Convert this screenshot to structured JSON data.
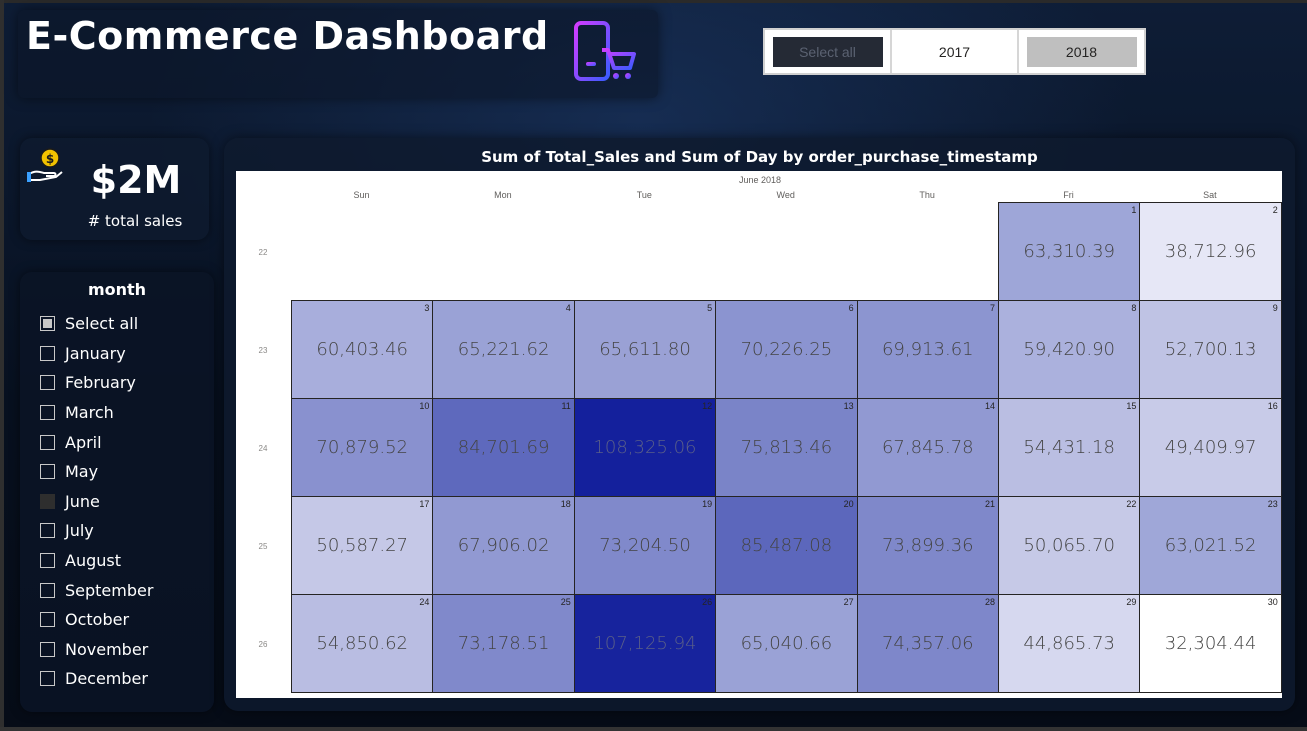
{
  "header": {
    "title": "E-Commerce Dashboard",
    "icon": "phone-shopping-cart-icon"
  },
  "year_slicer": {
    "options": [
      {
        "label": "Select all",
        "state": "dark"
      },
      {
        "label": "2017",
        "state": "white"
      },
      {
        "label": "2018",
        "state": "grey"
      }
    ]
  },
  "kpi": {
    "value": "$2M",
    "label": "# total sales",
    "icon": "hand-coin-icon"
  },
  "month_slicer": {
    "header": "month",
    "items": [
      {
        "label": "Select all",
        "check": "partial"
      },
      {
        "label": "January",
        "check": "none"
      },
      {
        "label": "February",
        "check": "none"
      },
      {
        "label": "March",
        "check": "none"
      },
      {
        "label": "April",
        "check": "none"
      },
      {
        "label": "May",
        "check": "none"
      },
      {
        "label": "June",
        "check": "filled"
      },
      {
        "label": "July",
        "check": "none"
      },
      {
        "label": "August",
        "check": "none"
      },
      {
        "label": "September",
        "check": "none"
      },
      {
        "label": "October",
        "check": "none"
      },
      {
        "label": "November",
        "check": "none"
      },
      {
        "label": "December",
        "check": "none"
      }
    ]
  },
  "calendar": {
    "title": "Sum of Total_Sales and Sum of Day by order_purchase_timestamp",
    "month_label": "June 2018",
    "weekdays": [
      "Sun",
      "Mon",
      "Tue",
      "Wed",
      "Thu",
      "Fri",
      "Sat"
    ],
    "weeks": [
      "22",
      "23",
      "24",
      "25",
      "26"
    ],
    "days": [
      {
        "day": "1",
        "value": "63,310.39",
        "color": "#9ea6d8",
        "text": "#444444"
      },
      {
        "day": "2",
        "value": "38,712.96",
        "color": "#e6e7f6",
        "text": "#444444"
      },
      {
        "day": "3",
        "value": "60,403.46",
        "color": "#a8aedc",
        "text": "#444444"
      },
      {
        "day": "4",
        "value": "65,221.62",
        "color": "#9aa2d6",
        "text": "#444444"
      },
      {
        "day": "5",
        "value": "65,611.80",
        "color": "#9aa1d5",
        "text": "#444444"
      },
      {
        "day": "6",
        "value": "70,226.25",
        "color": "#8b94d0",
        "text": "#444444"
      },
      {
        "day": "7",
        "value": "69,913.61",
        "color": "#8c95d0",
        "text": "#444444"
      },
      {
        "day": "8",
        "value": "59,420.90",
        "color": "#abb1dd",
        "text": "#444444"
      },
      {
        "day": "9",
        "value": "52,700.13",
        "color": "#bfc3e4",
        "text": "#444444"
      },
      {
        "day": "10",
        "value": "70,879.52",
        "color": "#8991cf",
        "text": "#444444"
      },
      {
        "day": "11",
        "value": "84,701.69",
        "color": "#5e69bd",
        "text": "#444444"
      },
      {
        "day": "12",
        "value": "108,325.06",
        "color": "#14209c",
        "text": "#5a5f88"
      },
      {
        "day": "13",
        "value": "75,813.46",
        "color": "#7a84c8",
        "text": "#444444"
      },
      {
        "day": "14",
        "value": "67,845.78",
        "color": "#9199d2",
        "text": "#444444"
      },
      {
        "day": "15",
        "value": "54,431.18",
        "color": "#babee2",
        "text": "#444444"
      },
      {
        "day": "16",
        "value": "49,409.97",
        "color": "#c8cbe8",
        "text": "#444444"
      },
      {
        "day": "17",
        "value": "50,587.27",
        "color": "#c5c8e7",
        "text": "#444444"
      },
      {
        "day": "18",
        "value": "67,906.02",
        "color": "#9199d2",
        "text": "#444444"
      },
      {
        "day": "19",
        "value": "73,204.50",
        "color": "#8089cb",
        "text": "#444444"
      },
      {
        "day": "20",
        "value": "85,487.08",
        "color": "#5c67bc",
        "text": "#444444"
      },
      {
        "day": "21",
        "value": "73,899.36",
        "color": "#7f88ca",
        "text": "#444444"
      },
      {
        "day": "22",
        "value": "50,065.70",
        "color": "#c6c9e7",
        "text": "#444444"
      },
      {
        "day": "23",
        "value": "63,021.52",
        "color": "#9fa7d8",
        "text": "#444444"
      },
      {
        "day": "24",
        "value": "54,850.62",
        "color": "#b9bde2",
        "text": "#444444"
      },
      {
        "day": "25",
        "value": "73,178.51",
        "color": "#8089cb",
        "text": "#444444"
      },
      {
        "day": "26",
        "value": "107,125.94",
        "color": "#17239d",
        "text": "#5a5f88"
      },
      {
        "day": "27",
        "value": "65,040.66",
        "color": "#9aa2d6",
        "text": "#444444"
      },
      {
        "day": "28",
        "value": "74,357.06",
        "color": "#7e87ca",
        "text": "#444444"
      },
      {
        "day": "29",
        "value": "44,865.73",
        "color": "#d6d8ef",
        "text": "#444444"
      },
      {
        "day": "30",
        "value": "32,304.44",
        "color": "#ffffff",
        "text": "#444444"
      }
    ]
  }
}
